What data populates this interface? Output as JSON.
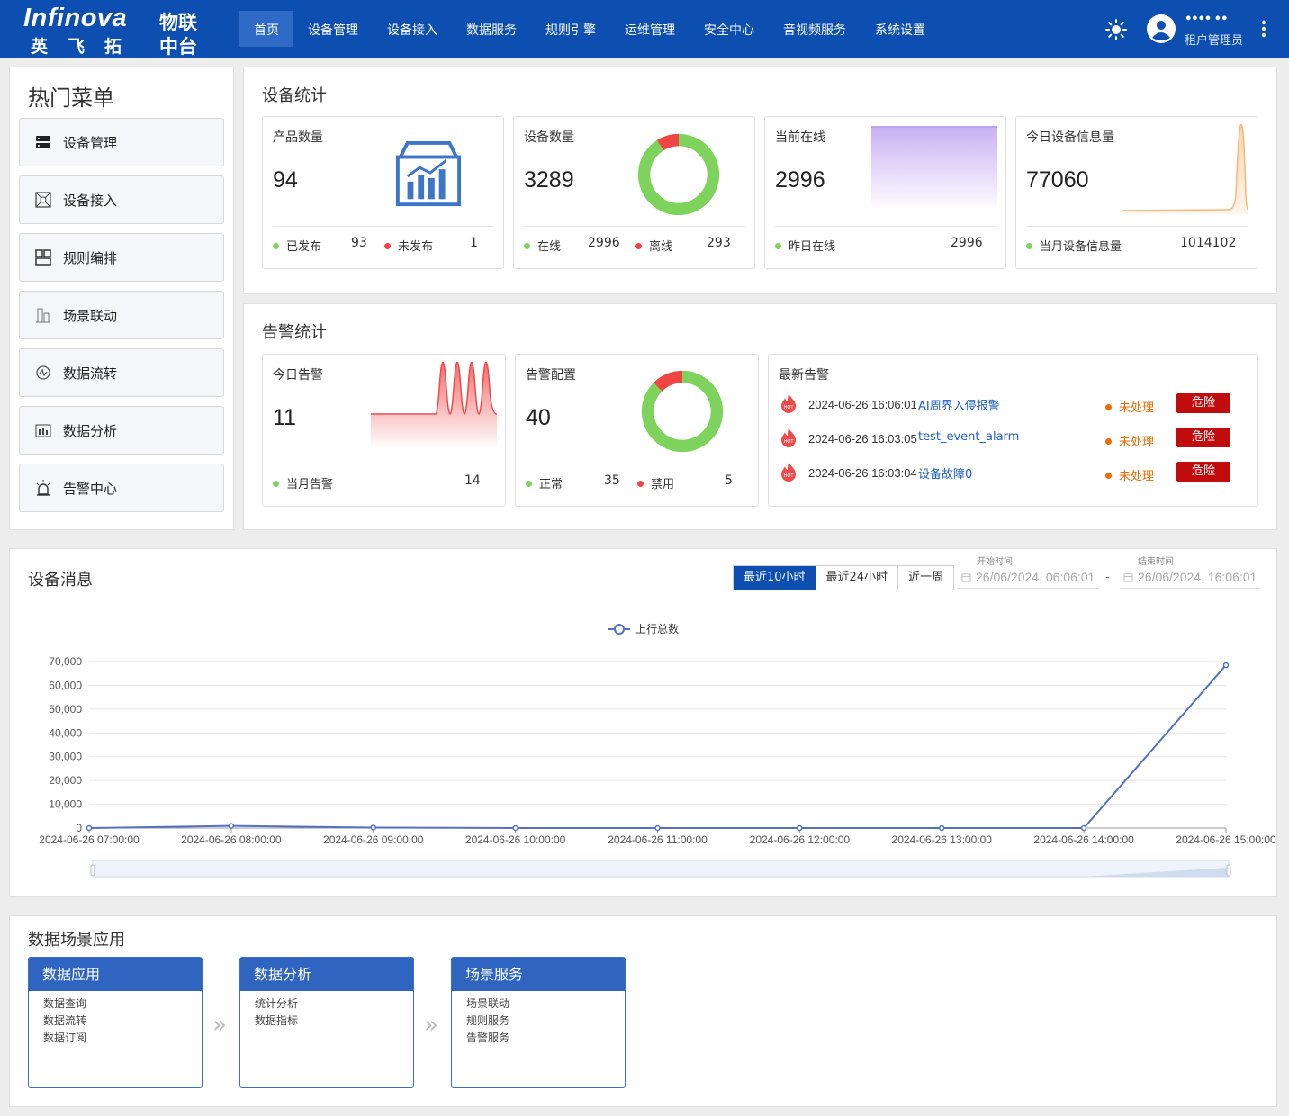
{
  "header": {
    "logo_en": "Infinova",
    "logo_cn1": "英飞拓",
    "logo_cn2": "物联",
    "logo_cn3": "中台",
    "nav": [
      "首页",
      "设备管理",
      "设备接入",
      "数据服务",
      "规则引擎",
      "运维管理",
      "安全中心",
      "音视频服务",
      "系统设置"
    ],
    "active_nav": "首页",
    "user_name": "•••• ••",
    "user_role": "租户管理员"
  },
  "hot_menu": {
    "title": "热门菜单",
    "items": [
      {
        "label": "设备管理",
        "icon": "server-icon"
      },
      {
        "label": "设备接入",
        "icon": "network-icon"
      },
      {
        "label": "规则编排",
        "icon": "layout-icon"
      },
      {
        "label": "场景联动",
        "icon": "building-icon"
      },
      {
        "label": "数据流转",
        "icon": "flow-icon"
      },
      {
        "label": "数据分析",
        "icon": "bar-chart-icon"
      },
      {
        "label": "告警中心",
        "icon": "alarm-light-icon"
      }
    ]
  },
  "device_stats": {
    "title": "设备统计",
    "product": {
      "label": "产品数量",
      "value": "94",
      "published_label": "已发布",
      "published": "93",
      "unpublished_label": "未发布",
      "unpublished": "1"
    },
    "device": {
      "label": "设备数量",
      "value": "3289",
      "online_label": "在线",
      "online": "2996",
      "offline_label": "离线",
      "offline": "293"
    },
    "current_online": {
      "label": "当前在线",
      "value": "2996",
      "yesterday_label": "昨日在线",
      "yesterday": "2996"
    },
    "today_msgs": {
      "label": "今日设备信息量",
      "value": "77060",
      "month_label": "当月设备信息量",
      "month": "1014102"
    }
  },
  "alarm_stats": {
    "title": "告警统计",
    "today": {
      "label": "今日告警",
      "value": "11",
      "month_label": "当月告警",
      "month": "14"
    },
    "config": {
      "label": "告警配置",
      "value": "40",
      "normal_label": "正常",
      "normal": "35",
      "disabled_label": "禁用",
      "disabled": "5"
    },
    "latest": {
      "label": "最新告警",
      "rows": [
        {
          "time": "2024-06-26 16:06:01",
          "name": "AI周界入侵报警",
          "status": "未处理",
          "level": "危险"
        },
        {
          "time": "2024-06-26 16:03:05",
          "name": "test_event_alarm",
          "status": "未处理",
          "level": "危险"
        },
        {
          "time": "2024-06-26 16:03:04",
          "name": "设备故障0",
          "status": "未处理",
          "level": "危险"
        }
      ]
    }
  },
  "device_messages": {
    "title": "设备消息",
    "ranges": [
      "最近10小时",
      "最近24小时",
      "近一周"
    ],
    "start_label": "开始时间",
    "start": "26/06/2024, 06:06:01",
    "separator": "-",
    "end_label": "结束时间",
    "end": "26/06/2024, 16:06:01"
  },
  "chart_data": {
    "type": "line",
    "series": [
      {
        "name": "上行总数",
        "values": [
          0,
          900,
          200,
          0,
          0,
          0,
          0,
          0,
          68500
        ]
      }
    ],
    "x": [
      "2024-06-26 07:00:00",
      "2024-06-26 08:00:00",
      "2024-06-26 09:00:00",
      "2024-06-26 10:00:00",
      "2024-06-26 11:00:00",
      "2024-06-26 12:00:00",
      "2024-06-26 13:00:00",
      "2024-06-26 14:00:00",
      "2024-06-26 15:00:00"
    ],
    "y_ticks": [
      "0",
      "10,000",
      "20,000",
      "30,000",
      "40,000",
      "50,000",
      "60,000",
      "70,000"
    ],
    "ylim": [
      0,
      70000
    ],
    "legend": "top-center",
    "grid": true,
    "color": "#5470c6"
  },
  "scenes": {
    "title": "数据场景应用",
    "cards": [
      {
        "title": "数据应用",
        "items": [
          "数据查询",
          "数据流转",
          "数据订阅"
        ]
      },
      {
        "title": "数据分析",
        "items": [
          "统计分析",
          "数据指标"
        ]
      },
      {
        "title": "场景服务",
        "items": [
          "场景联动",
          "规则服务",
          "告警服务"
        ]
      }
    ],
    "arrow": "»"
  },
  "colors": {
    "brand": "#0d4fb0",
    "green": "#7ed35c",
    "red": "#f04545",
    "danger": "#c00c0c",
    "pending": "#f06a00"
  }
}
